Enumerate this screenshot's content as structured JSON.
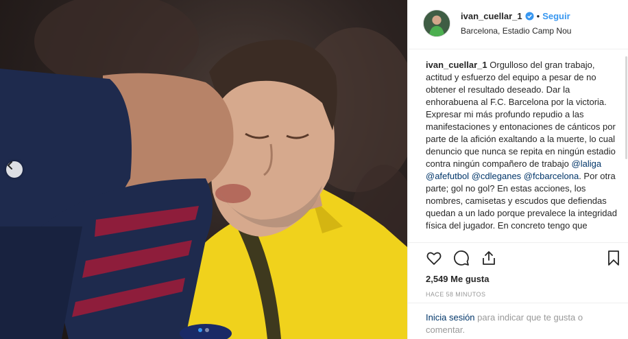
{
  "post": {
    "username": "ivan_cuellar_1",
    "separator": "•",
    "follow_label": "Seguir",
    "location": "Barcelona, Estadio Camp Nou",
    "caption_user": "ivan_cuellar_1",
    "caption_text_1": "Orgulloso del gran trabajo, actitud y esfuerzo del equipo a pesar de no obtener el resultado deseado. Dar la enhorabuena al F.C. Barcelona por la victoria. Expresar mi más profundo repudio a las manifestaciones y entonaciones de cánticos por parte de la afición exaltando a la muerte, lo cual denuncio que nunca se repita en ningún estadio contra ningún compañero de trabajo",
    "mention_1": "@laliga",
    "mention_2": "@afefutbol",
    "mention_3": "@cdleganes",
    "mention_4": "@fcbarcelona",
    "caption_text_2": ". Por otra parte; gol no gol? En estas acciones, los nombres, camisetas y escudos que defiendas quedan a un lado porque prevalece la integridad física del jugador. En concreto tengo que",
    "likes": "2,549 Me gusta",
    "timestamp": "HACE 58 MINUTOS",
    "login_link": "Inicia sesión",
    "login_text": "para indicar que te gusta o comentar."
  },
  "carousel": {
    "dot_count": 2,
    "active_dot": 1
  },
  "icons": {
    "prev": "chevron-left-icon",
    "like": "heart-icon",
    "comment": "comment-bubble-icon",
    "share": "share-icon",
    "save": "bookmark-icon",
    "verified": "verified-badge-icon"
  },
  "colors": {
    "link_blue": "#3897f0",
    "mention_blue": "#003569",
    "text": "#262626",
    "muted": "#999999",
    "jersey_yellow": "#f0d21c",
    "jersey_navy": "#1e2a4d"
  }
}
